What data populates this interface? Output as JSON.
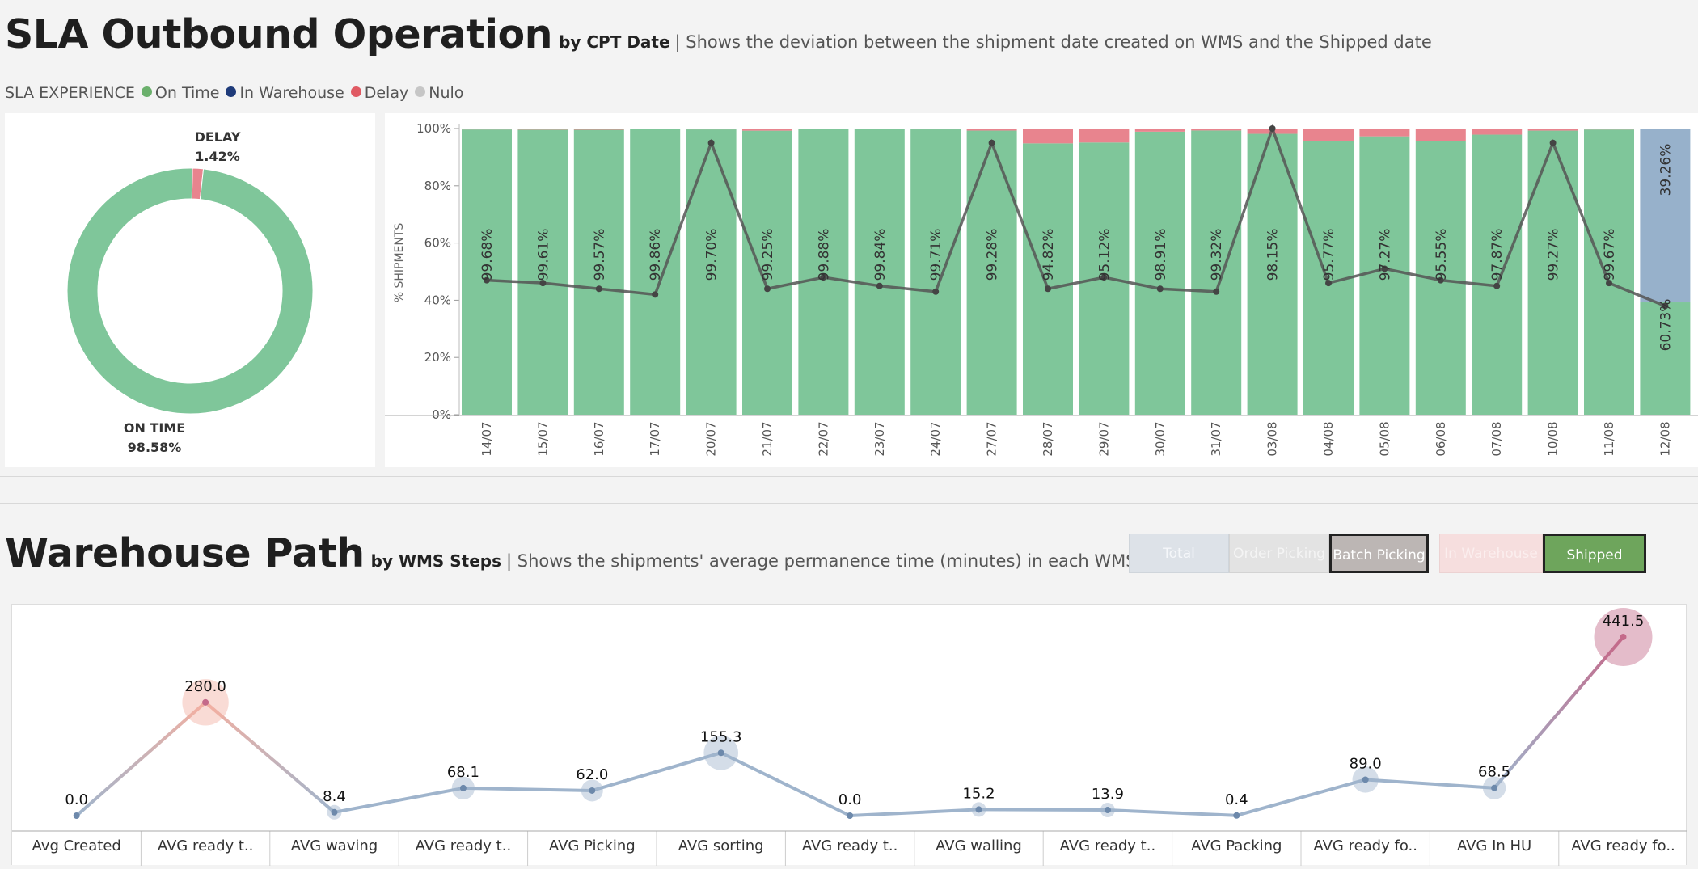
{
  "section1": {
    "title": "SLA Outbound Operation",
    "by_label": "by CPT Date",
    "subtitle": "| Shows the deviation between the shipment date created  on WMS and the Shipped date"
  },
  "legend": {
    "label": "SLA EXPERIENCE",
    "items": [
      {
        "label": "On Time",
        "color": "#6bb06c"
      },
      {
        "label": "In Warehouse",
        "color": "#1f3b7a"
      },
      {
        "label": "Delay",
        "color": "#e05a63"
      },
      {
        "label": "Nulo",
        "color": "#c6c6c6"
      }
    ]
  },
  "section2": {
    "title": "Warehouse Path",
    "by_label": "by WMS Steps",
    "subtitle": "| Shows the shipments' average permanence time (minutes) in each WMS step"
  },
  "filters": {
    "group1": [
      "Total",
      "Order Picking",
      "Batch Picking"
    ],
    "group1_selected": "Batch Picking",
    "group2": [
      "In Warehouse",
      "Shipped"
    ],
    "group2_selected": "Shipped"
  },
  "chart_data": [
    {
      "type": "pie",
      "donut": true,
      "slices": [
        {
          "label": "DELAY",
          "value": 1.42,
          "text": "1.42%",
          "color": "#e8848e"
        },
        {
          "label": "ON TIME",
          "value": 98.58,
          "text": "98.58%",
          "color": "#7fc69a"
        }
      ]
    },
    {
      "type": "bar",
      "stacked": true,
      "ylabel": "% SHIPMENTS",
      "ylim": [
        0,
        100
      ],
      "yticks": [
        "0%",
        "20%",
        "40%",
        "60%",
        "80%",
        "100%"
      ],
      "categories": [
        "14/07",
        "15/07",
        "16/07",
        "17/07",
        "20/07",
        "21/07",
        "22/07",
        "23/07",
        "24/07",
        "27/07",
        "28/07",
        "29/07",
        "30/07",
        "31/07",
        "03/08",
        "04/08",
        "05/08",
        "06/08",
        "07/08",
        "10/08",
        "11/08",
        "12/08"
      ],
      "series": [
        {
          "name": "On Time",
          "color": "#7fc69a",
          "values": [
            99.68,
            99.61,
            99.57,
            99.86,
            99.7,
            99.25,
            99.88,
            99.84,
            99.71,
            99.28,
            94.82,
            95.12,
            98.91,
            99.32,
            98.15,
            95.77,
            97.27,
            95.55,
            97.87,
            99.27,
            99.67,
            39.26
          ]
        },
        {
          "name": "Delay",
          "color": "#e8848e",
          "values": [
            0.32,
            0.39,
            0.43,
            0.14,
            0.3,
            0.75,
            0.12,
            0.16,
            0.29,
            0.72,
            5.18,
            4.88,
            1.09,
            0.68,
            1.85,
            4.23,
            2.73,
            4.45,
            2.13,
            0.73,
            0.33,
            0
          ]
        },
        {
          "name": "In Warehouse",
          "color": "#97b1cb",
          "values": [
            0,
            0,
            0,
            0,
            0,
            0,
            0,
            0,
            0,
            0,
            0,
            0,
            0,
            0,
            0,
            0,
            0,
            0,
            0,
            0,
            0,
            60.73
          ]
        }
      ],
      "bar_labels": [
        "99.68%",
        "99.61%",
        "99.57%",
        "99.86%",
        "99.70%",
        "99.25%",
        "99.88%",
        "99.84%",
        "99.71%",
        "99.28%",
        "94.82%",
        "95.12%",
        "98.91%",
        "99.32%",
        "98.15%",
        "95.77%",
        "97.27%",
        "95.55%",
        "97.87%",
        "99.27%",
        "99.67%",
        "39.26%"
      ],
      "extra_label": "60.73%",
      "line": {
        "values": [
          47,
          46,
          44,
          42,
          95,
          44,
          48,
          45,
          43,
          95,
          44,
          48,
          44,
          43,
          100,
          46,
          51,
          47,
          45,
          95,
          46,
          38
        ]
      }
    },
    {
      "type": "line",
      "categories": [
        "Avg Created",
        "AVG ready t..",
        "AVG waving",
        "AVG ready t..",
        "AVG Picking",
        "AVG sorting",
        "AVG ready t..",
        "AVG walling",
        "AVG ready t..",
        "AVG Packing",
        "AVG ready fo..",
        "AVG In HU",
        "AVG ready fo.."
      ],
      "values": [
        0.0,
        280.0,
        8.4,
        68.1,
        62.0,
        155.3,
        0.0,
        15.2,
        13.9,
        0.4,
        89.0,
        68.5,
        441.5
      ],
      "labels": [
        "0.0",
        "280.0",
        "8.4",
        "68.1",
        "62.0",
        "155.3",
        "0.0",
        "15.2",
        "13.9",
        "0.4",
        "89.0",
        "68.5",
        "441.5"
      ]
    }
  ]
}
